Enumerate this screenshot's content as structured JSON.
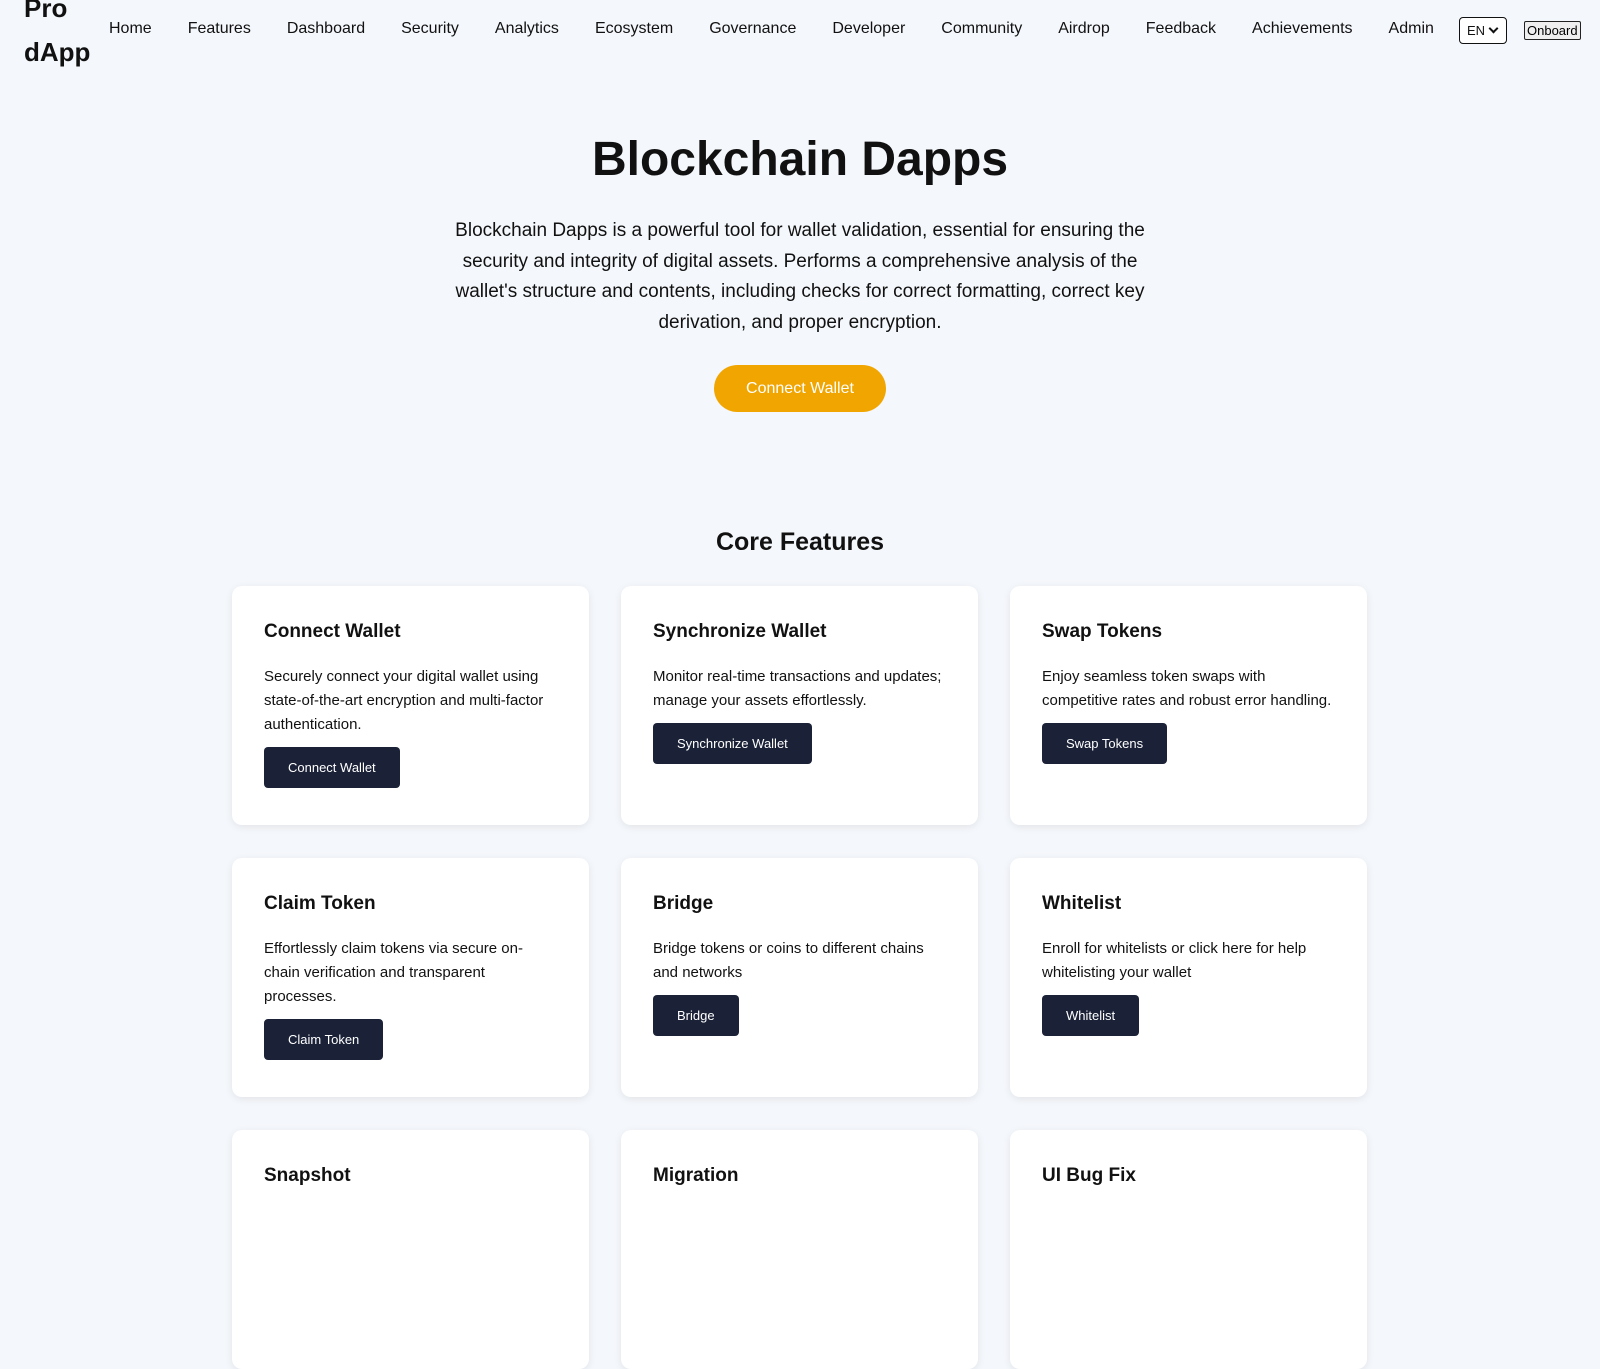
{
  "header": {
    "logo": "Pro dApp",
    "nav": [
      "Home",
      "Features",
      "Dashboard",
      "Security",
      "Analytics",
      "Ecosystem",
      "Governance",
      "Developer",
      "Community",
      "Airdrop",
      "Feedback",
      "Achievements",
      "Admin"
    ],
    "language": "EN",
    "onboard_label": "Onboard"
  },
  "hero": {
    "title": "Blockchain Dapps",
    "description": "Blockchain Dapps is a powerful tool for wallet validation, essential for ensuring the security and integrity of digital assets. Performs a comprehensive analysis of the wallet's structure and contents, including checks for correct formatting, correct key derivation, and proper encryption.",
    "cta": "Connect Wallet"
  },
  "features": {
    "title": "Core Features",
    "cards": [
      {
        "title": "Connect Wallet",
        "description": "Securely connect your digital wallet using state-of-the-art encryption and multi-factor authentication.",
        "button": "Connect Wallet"
      },
      {
        "title": "Synchronize Wallet",
        "description": "Monitor real-time transactions and updates; manage your assets effortlessly.",
        "button": "Synchronize Wallet"
      },
      {
        "title": "Swap Tokens",
        "description": "Enjoy seamless token swaps with competitive rates and robust error handling.",
        "button": "Swap Tokens"
      },
      {
        "title": "Claim Token",
        "description": "Effortlessly claim tokens via secure on-chain verification and transparent processes.",
        "button": "Claim Token"
      },
      {
        "title": "Bridge",
        "description": "Bridge tokens or coins to different chains and networks",
        "button": "Bridge"
      },
      {
        "title": "Whitelist",
        "description": "Enroll for whitelists or click here for help whitelisting your wallet",
        "button": "Whitelist"
      },
      {
        "title": "Snapshot",
        "description": "",
        "button": ""
      },
      {
        "title": "Migration",
        "description": "",
        "button": ""
      },
      {
        "title": "UI Bug Fix",
        "description": "",
        "button": ""
      }
    ]
  },
  "colors": {
    "background": "#f4f7fb",
    "accent": "#f0a500",
    "button_dark": "#1b2238"
  }
}
